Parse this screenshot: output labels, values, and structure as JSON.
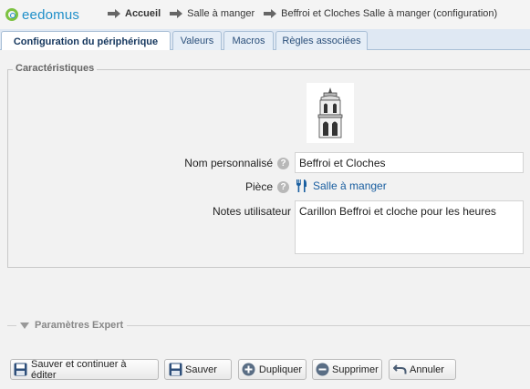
{
  "app": {
    "logo_text": "eedomus"
  },
  "breadcrumbs": [
    {
      "label": "Accueil"
    },
    {
      "label": "Salle à manger"
    },
    {
      "label": "Beffroi et Cloches Salle à manger (configuration)"
    }
  ],
  "tabs": [
    {
      "label": "Configuration du périphérique"
    },
    {
      "label": "Valeurs"
    },
    {
      "label": "Macros"
    },
    {
      "label": "Règles associées"
    }
  ],
  "characteristics": {
    "legend": "Caractéristiques",
    "device_image": "bell-tower-image",
    "name_label": "Nom personnalisé",
    "name_value": "Beffroi et Cloches",
    "room_label": "Pièce",
    "room_value": "Salle à manger",
    "room_icon": "fork-knife-icon",
    "notes_label": "Notes utilisateur",
    "notes_value": "Carillon Beffroi et cloche pour les heures",
    "help_glyph": "?"
  },
  "expert": {
    "label": "Paramètres Expert"
  },
  "buttons": {
    "save_continue": "Sauver et continuer à éditer",
    "save": "Sauver",
    "duplicate": "Dupliquer",
    "delete": "Supprimer",
    "cancel": "Annuler"
  },
  "colors": {
    "brand_blue": "#1f8fc9",
    "brand_green": "#7dc242",
    "tab_bg": "#dfe8f3",
    "link": "#1a5fa0"
  }
}
